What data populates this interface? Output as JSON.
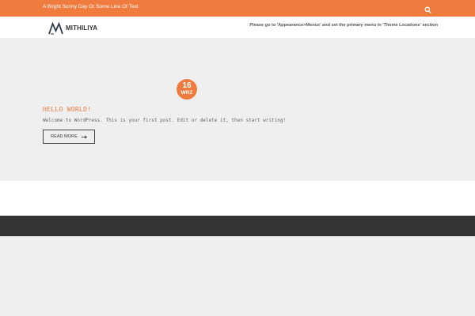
{
  "colors": {
    "accent": "#ef7b3f",
    "dark_footer": "#333333",
    "page_background": "#efefef"
  },
  "topbar": {
    "tagline": "A Bright Sunny Day Or Some Line Of Text",
    "search_icon": "search-icon"
  },
  "header": {
    "logo_text": "MITHILIYA",
    "logo_icon": "m-logo-icon",
    "menu_notice": "Please go to 'Appearance>Menus' and set the primary menu in 'Theme Locations' section"
  },
  "post": {
    "date_day": "16",
    "date_month": "WRZ",
    "title": "HELLO WORLD!",
    "excerpt": "Welcome to WordPress. This is your first post. Edit or delete it, then start writing!",
    "read_more_label": "READ MORE",
    "read_more_icon": "arrow-right-icon"
  }
}
